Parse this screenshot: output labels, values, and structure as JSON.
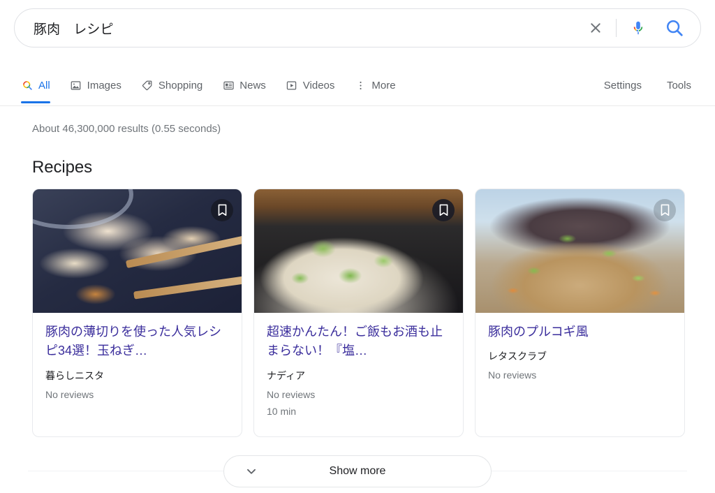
{
  "search": {
    "query": "豚肉　レシピ",
    "placeholder": "Search",
    "clear_label": "Clear",
    "mic_label": "Search by voice",
    "submit_label": "Google Search"
  },
  "nav": {
    "tabs": [
      {
        "label": "All",
        "icon": "search-icon",
        "active": true
      },
      {
        "label": "Images",
        "icon": "image-icon",
        "active": false
      },
      {
        "label": "Shopping",
        "icon": "tag-icon",
        "active": false
      },
      {
        "label": "News",
        "icon": "news-icon",
        "active": false
      },
      {
        "label": "Videos",
        "icon": "video-icon",
        "active": false
      },
      {
        "label": "More",
        "icon": "more-vertical-icon",
        "active": false
      }
    ],
    "settings_label": "Settings",
    "tools_label": "Tools"
  },
  "results": {
    "stats": "About 46,300,000 results (0.55 seconds)"
  },
  "recipes_section": {
    "heading": "Recipes",
    "cards": [
      {
        "title": "豚肉の薄切りを使った人気レシピ34選！玉ねぎ…",
        "source": "暮らしニスタ",
        "reviews": "No reviews",
        "time": "",
        "bookmark_style": "dark"
      },
      {
        "title": "超速かんたん！ご飯もお酒も止まらない！『塩…",
        "source": "ナディア",
        "reviews": "No reviews",
        "time": "10 min",
        "bookmark_style": "dark"
      },
      {
        "title": "豚肉のプルコギ風",
        "source": "レタスクラブ",
        "reviews": "No reviews",
        "time": "",
        "bookmark_style": "light"
      }
    ],
    "show_more_label": "Show more"
  },
  "colors": {
    "link": "#3b2e9c",
    "accent_blue": "#1a73e8",
    "muted_text": "#70757a",
    "primary_text": "#202124",
    "border": "#e8eaed"
  }
}
